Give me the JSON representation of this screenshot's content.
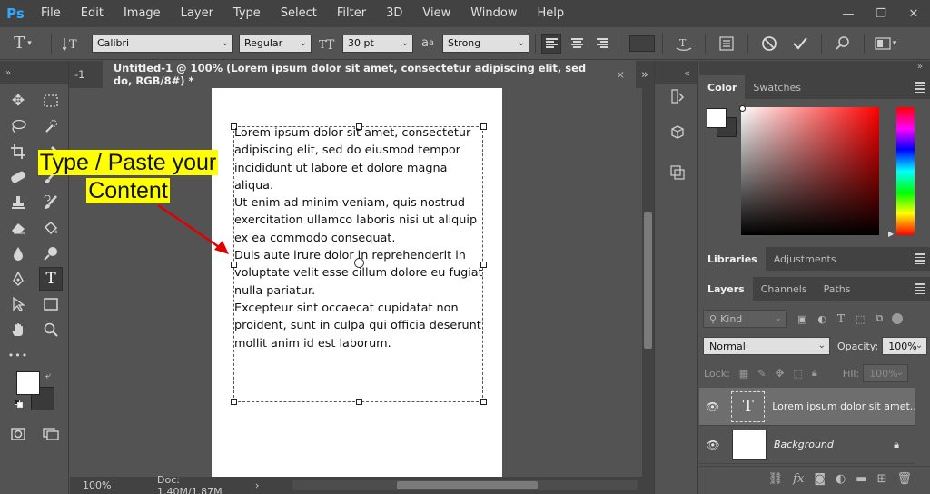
{
  "app": {
    "logo": "Ps",
    "menu": [
      "File",
      "Edit",
      "Image",
      "Layer",
      "Type",
      "Select",
      "Filter",
      "3D",
      "View",
      "Window",
      "Help"
    ],
    "window_controls": {
      "minimize": "—",
      "restore": "❐",
      "close": "✕"
    }
  },
  "options": {
    "tool_icon": "T",
    "font_family": "Calibri",
    "font_style": "Regular",
    "font_size": "30 pt",
    "aa_label": "a",
    "aa_label_small": "a",
    "anti_alias": "Strong",
    "text_color": "#404040"
  },
  "tabs": {
    "prev_tab": "-1",
    "active_title": "Untitled-1 @ 100% (Lorem ipsum dolor sit amet, consectetur adipiscing elit, sed do, RGB/8#) *",
    "close": "×",
    "overflow": "»"
  },
  "canvas": {
    "paragraphs": [
      "Lorem ipsum dolor sit amet, consectetur adipiscing elit, sed do eiusmod tempor incididunt ut labore et dolore magna aliqua.",
      "Ut enim ad minim veniam, quis nostrud exercitation ullamco laboris nisi ut aliquip ex ea commodo consequat.",
      "Duis aute irure dolor in reprehenderit in voluptate velit esse cillum dolore eu fugiat nulla pariatur.",
      "Excepteur sint occaecat cupidatat non proident, sunt in culpa qui officia deserunt mollit anim id est laborum."
    ],
    "annotation_line1": "Type / Paste your",
    "annotation_line2": "Content",
    "annotation_color": "#ffff00",
    "arrow_color": "#ff0000"
  },
  "status": {
    "zoom": "100%",
    "doc": "Doc: 1.40M/1.87M",
    "arrow": "›"
  },
  "color_panel": {
    "tabs": [
      "Color",
      "Swatches"
    ],
    "foreground": "#ffffff",
    "background": "#3a3a3a"
  },
  "libraries_panel": {
    "tabs": [
      "Libraries",
      "Adjustments"
    ]
  },
  "layers_panel": {
    "tabs": [
      "Layers",
      "Channels",
      "Paths"
    ],
    "kind_label": "Kind",
    "blend_mode": "Normal",
    "opacity_label": "Opacity:",
    "opacity_value": "100%",
    "lock_label": "Lock:",
    "fill_label": "Fill:",
    "fill_value": "100%",
    "layers": [
      {
        "name": "Lorem ipsum dolor sit amet...",
        "type": "text",
        "thumb_glyph": "T"
      },
      {
        "name": "Background",
        "type": "background"
      }
    ]
  },
  "toolbar": {
    "more": "•••"
  }
}
